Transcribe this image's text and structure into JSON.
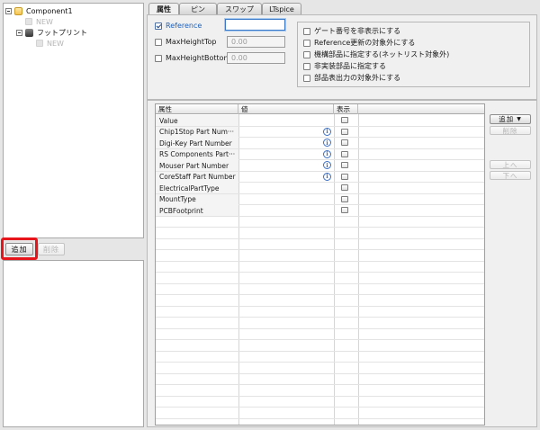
{
  "tree": {
    "root_label": "Component1",
    "root_new": "NEW",
    "footprint_label": "フットプリント",
    "footprint_new": "NEW"
  },
  "left_buttons": {
    "add": "追加",
    "delete": "削除"
  },
  "tabs": [
    {
      "label": "属性",
      "active": true
    },
    {
      "label": "ピン",
      "active": false
    },
    {
      "label": "スワップ",
      "active": false
    },
    {
      "label": "LTspice",
      "active": false
    }
  ],
  "props": {
    "reference_label": "Reference",
    "reference_value": "",
    "maxheighttop_label": "MaxHeightTop",
    "maxheighttop_value": "0.00",
    "maxheightbottom_label": "MaxHeightBottom",
    "maxheightbottom_value": "0.00"
  },
  "options": [
    "ゲート番号を非表示にする",
    "Reference更新の対象外にする",
    "機構部品に指定する(ネットリスト対象外)",
    "非実装部品に指定する",
    "部品表出力の対象外にする"
  ],
  "table": {
    "headers": {
      "attribute": "属性",
      "value": "値",
      "show": "表示"
    },
    "rows": [
      {
        "name": "Value",
        "info": false
      },
      {
        "name": "Chip1Stop Part Num···",
        "info": true
      },
      {
        "name": "Digi-Key Part Number",
        "info": true
      },
      {
        "name": "RS Components Part···",
        "info": true
      },
      {
        "name": "Mouser Part Number",
        "info": true
      },
      {
        "name": "CoreStaff Part Number",
        "info": true
      },
      {
        "name": "ElectricalPartType",
        "info": false
      },
      {
        "name": "MountType",
        "info": false
      },
      {
        "name": "PCBFootprint",
        "info": false
      }
    ]
  },
  "side_buttons": {
    "add": "追加",
    "delete": "削除",
    "up": "上へ",
    "down": "下へ"
  },
  "colors": {
    "highlight": "#e8141b",
    "info": "#3a6fc5",
    "reference_label": "#1d5fb8"
  }
}
